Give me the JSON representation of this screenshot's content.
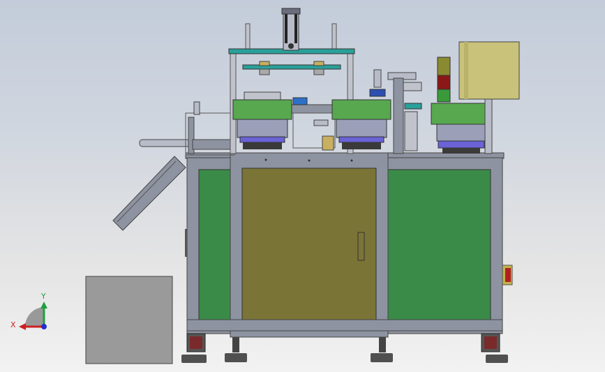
{
  "viewport": {
    "background_top": "#c3ccda",
    "background_bottom": "#f2f2f2"
  },
  "triad": {
    "x_label": "X",
    "y_label": "Y",
    "x_color": "#cc2020",
    "y_color": "#20a040",
    "z_color": "#2030cc"
  },
  "colors": {
    "frame": "#8e93a1",
    "frame_dark": "#5a5e6a",
    "panel_green": "#3a8b48",
    "door_olive": "#7b7437",
    "bowl_green": "#57a84f",
    "bowl_base": "#9b9fb8",
    "bowl_ring": "#6a62d6",
    "control_box": "#c9c27a",
    "tower_green": "#3a9a3a",
    "tower_red": "#8a1818",
    "tower_amber": "#8a8a30",
    "enclosure": "#9a9a9a",
    "cylinder": "#2aa09a"
  },
  "parts": {
    "feeder_bowl_count": 3,
    "status_tower_segments": [
      "amber",
      "red",
      "green"
    ],
    "has_emergency_stop": true
  }
}
